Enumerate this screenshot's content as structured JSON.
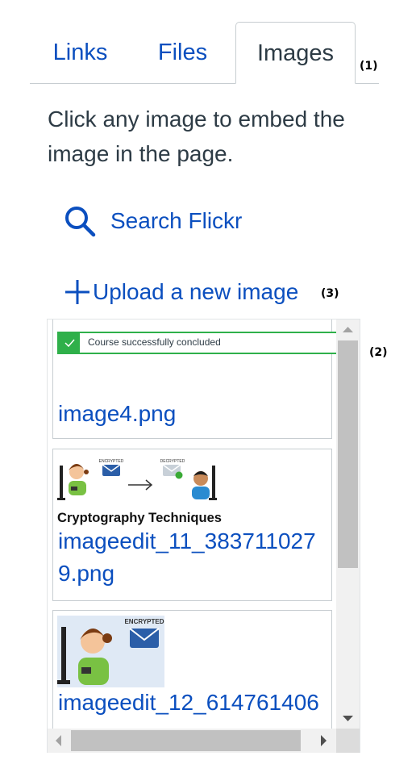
{
  "tabs": [
    {
      "label": "Links"
    },
    {
      "label": "Files"
    },
    {
      "label": "Images"
    }
  ],
  "markers": {
    "m1": "(1)",
    "m2": "(2)",
    "m3": "(3)"
  },
  "instructions": "Click any image to embed the image in the page.",
  "search": {
    "label": "Search Flickr",
    "icon": "search-icon"
  },
  "upload": {
    "label": "Upload a new image",
    "icon": "plus-icon"
  },
  "images": [
    {
      "name": "image4.png",
      "notice_text": "Course successfully concluded",
      "notice_close": "×"
    },
    {
      "name": "imageedit_11_3837110279.png",
      "thumb_caption": "Cryptography Techniques",
      "thumb_label_left": "ENCRYPTED",
      "thumb_label_right": "DECRYPTED"
    },
    {
      "name": "imageedit_12_614761406",
      "thumb_label": "ENCRYPTED"
    }
  ],
  "colors": {
    "link": "#0b4fbf",
    "text": "#2d3b45",
    "success": "#2fb04a",
    "border": "#c7cdd1"
  }
}
